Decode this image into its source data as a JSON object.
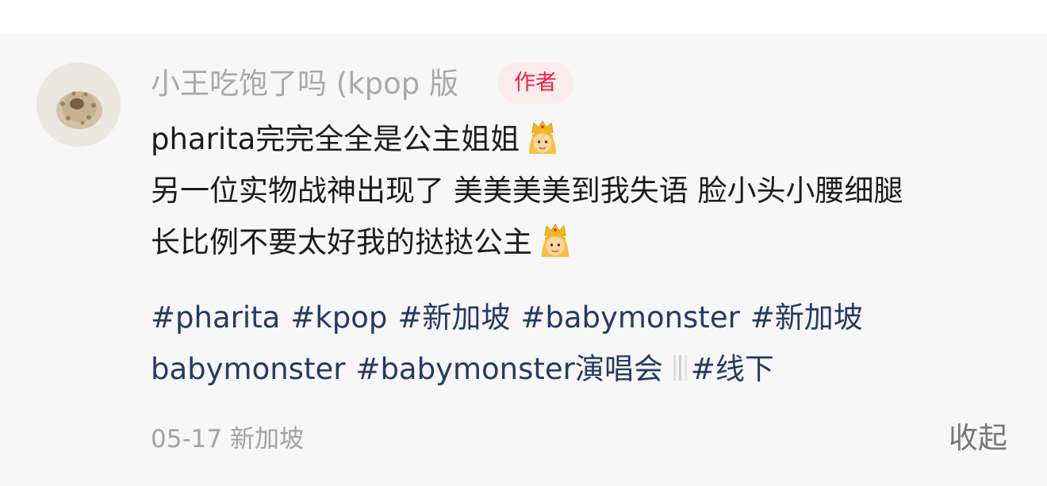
{
  "comment": {
    "username": "小王吃饱了吗 (kpop 版",
    "author_badge": "作者",
    "lines": [
      "pharita完完全全是公主姐姐",
      "另一位实物战神出现了 美美美美到我失语 脸小头小腰细腿",
      "长比例不要太好我的挞挞公主"
    ],
    "line_emoji": "princess-emoji",
    "hashtags": [
      "#pharita",
      "#kpop",
      "#新加坡",
      "#babymonster",
      "#新加坡",
      "babymonster",
      "#babymonster演唱会",
      "#线下"
    ],
    "date": "05-17",
    "location": "新加坡",
    "collapse_label": "收起"
  },
  "colors": {
    "card_background": "#f7f7f7",
    "username": "#a9a9a9",
    "badge_text": "#ee2246",
    "badge_background": "#fcebed",
    "body_text": "#1c1c1c",
    "hashtag": "#243a66",
    "meta_text": "#a2a2a2",
    "collapse_text": "#777777"
  }
}
